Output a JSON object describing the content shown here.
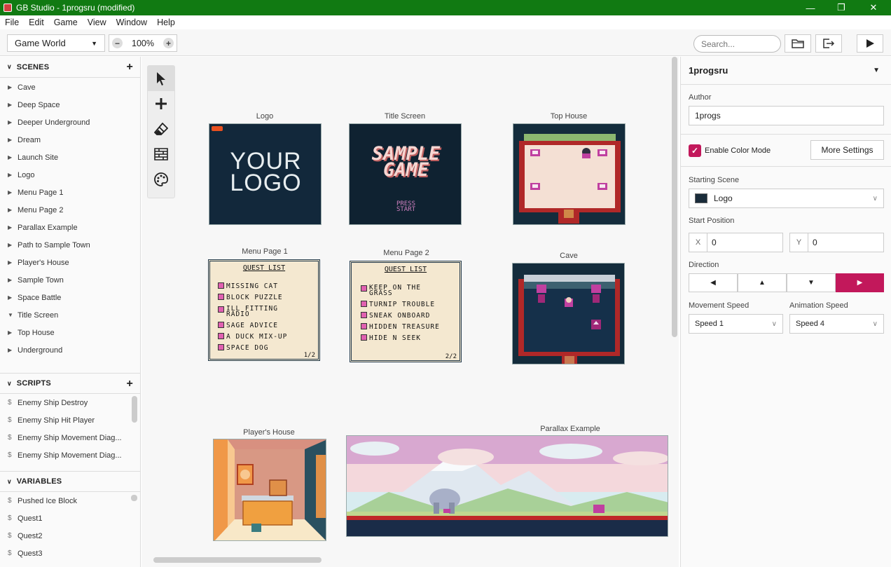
{
  "window": {
    "title": "GB Studio - 1progsru (modified)"
  },
  "menu": [
    "File",
    "Edit",
    "Game",
    "View",
    "Window",
    "Help"
  ],
  "toolbar": {
    "view_select": "Game World",
    "zoom": "100%",
    "search_placeholder": "Search..."
  },
  "scenes_section": {
    "title": "SCENES",
    "items": [
      "Cave",
      "Deep Space",
      "Deeper Underground",
      "Dream",
      "Launch Site",
      "Logo",
      "Menu Page 1",
      "Menu Page 2",
      "Parallax Example",
      "Path to Sample Town",
      "Player's House",
      "Sample Town",
      "Space Battle",
      "Title Screen",
      "Top House",
      "Underground"
    ]
  },
  "scripts_section": {
    "title": "SCRIPTS",
    "items": [
      "Enemy Ship Destroy",
      "Enemy Ship Hit Player",
      "Enemy Ship Movement Diag...",
      "Enemy Ship Movement Diag..."
    ]
  },
  "variables_section": {
    "title": "VARIABLES",
    "items": [
      "Pushed Ice Block",
      "Quest1",
      "Quest2",
      "Quest3"
    ]
  },
  "canvas": {
    "scenes": [
      {
        "name": "Logo",
        "text": [
          "YOUR",
          "LOGO"
        ]
      },
      {
        "name": "Title Screen",
        "text": [
          "SAMPLE",
          "GAME",
          "PRESS",
          "START"
        ]
      },
      {
        "name": "Top House"
      },
      {
        "name": "Menu Page 1",
        "header": "QUEST LIST",
        "items": [
          "MISSING CAT",
          "BLOCK PUZZLE",
          "ILL FITTING RADIO",
          "SAGE ADVICE",
          "A DUCK MIX-UP",
          "SPACE DOG"
        ],
        "page": "1/2"
      },
      {
        "name": "Menu Page 2",
        "header": "QUEST LIST",
        "items": [
          "KEEP ON THE GRASS",
          "TURNIP TROUBLE",
          "SNEAK ONBOARD",
          "HIDDEN TREASURE",
          "HIDE N SEEK"
        ],
        "page": "2/2"
      },
      {
        "name": "Cave"
      },
      {
        "name": "Player's House"
      },
      {
        "name": "Parallax Example"
      }
    ]
  },
  "properties": {
    "project_name": "1progsru",
    "author_label": "Author",
    "author_value": "1progs",
    "color_mode_label": "Enable Color Mode",
    "more_settings": "More Settings",
    "starting_scene_label": "Starting Scene",
    "starting_scene_value": "Logo",
    "start_position_label": "Start Position",
    "x_label": "X",
    "x_value": "0",
    "y_label": "Y",
    "y_value": "0",
    "direction_label": "Direction",
    "movement_speed_label": "Movement Speed",
    "movement_speed_value": "Speed 1",
    "animation_speed_label": "Animation Speed",
    "animation_speed_value": "Speed 4"
  },
  "colors": {
    "titlebar": "#117a12",
    "accent": "#c2185b"
  }
}
